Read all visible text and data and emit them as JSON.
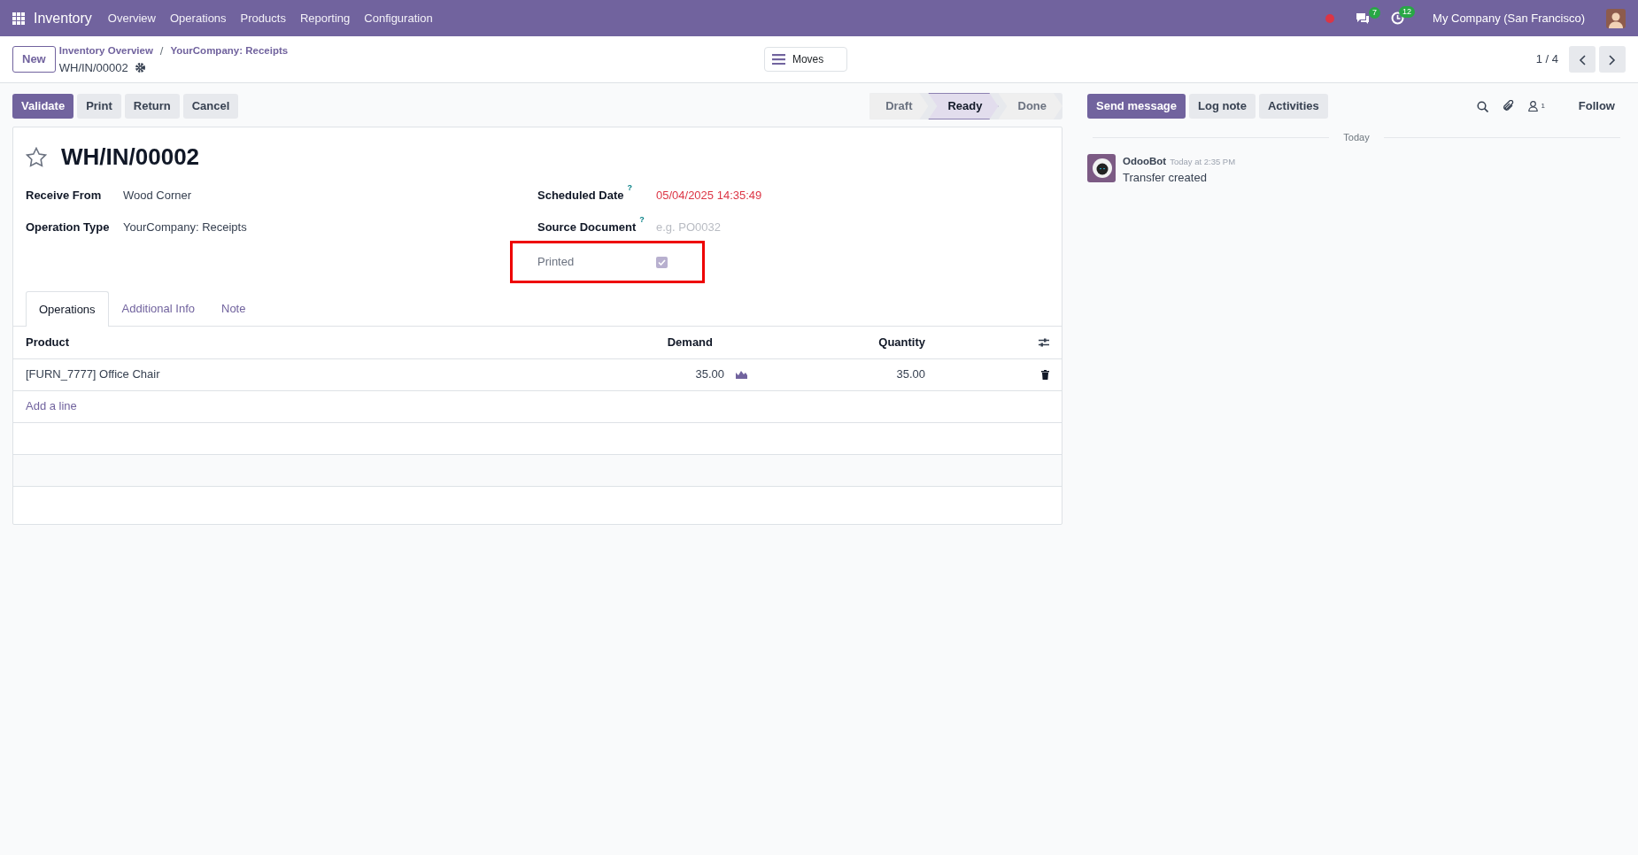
{
  "navbar": {
    "app_name": "Inventory",
    "menu": [
      "Overview",
      "Operations",
      "Products",
      "Reporting",
      "Configuration"
    ],
    "messages_count": "7",
    "activities_count": "12",
    "company": "My Company (San Francisco)"
  },
  "control_panel": {
    "new_button": "New",
    "breadcrumbs": [
      "Inventory Overview",
      "YourCompany: Receipts"
    ],
    "breadcrumb_separator": "/",
    "record_name": "WH/IN/00002",
    "smart_button": "Moves",
    "pager": "1 / 4"
  },
  "actions": [
    {
      "label": "Validate",
      "primary": true
    },
    {
      "label": "Print",
      "primary": false
    },
    {
      "label": "Return",
      "primary": false
    },
    {
      "label": "Cancel",
      "primary": false
    }
  ],
  "stages": [
    {
      "label": "Draft",
      "selected": false
    },
    {
      "label": "Ready",
      "selected": true
    },
    {
      "label": "Done",
      "selected": false
    }
  ],
  "form": {
    "title": "WH/IN/00002",
    "starred": false,
    "left_fields": [
      {
        "label": "Receive From",
        "value": "Wood Corner"
      },
      {
        "label": "Operation Type",
        "value": "YourCompany: Receipts"
      }
    ],
    "right_fields": [
      {
        "kind": "text",
        "label": "Scheduled Date",
        "help": "?",
        "value": "05/04/2025 14:35:49",
        "late": true
      },
      {
        "kind": "text",
        "label": "Source Document",
        "help": "?",
        "placeholder": "e.g. PO0032",
        "late": false
      },
      {
        "kind": "checkbox",
        "label": "Printed",
        "checked": true,
        "highlighted": true
      }
    ],
    "tabs": [
      {
        "label": "Operations",
        "selected": true
      },
      {
        "label": "Additional Info",
        "selected": false
      },
      {
        "label": "Note",
        "selected": false
      }
    ],
    "table": {
      "columns": [
        "Product",
        "Demand",
        "Quantity"
      ],
      "rows": [
        {
          "product": "[FURN_7777] Office Chair",
          "demand": "35.00",
          "quantity": "35.00"
        }
      ],
      "add_line": "Add a line"
    }
  },
  "chatter": {
    "buttons": [
      {
        "label": "Send message",
        "primary": true
      },
      {
        "label": "Log note",
        "primary": false
      },
      {
        "label": "Activities",
        "primary": false
      }
    ],
    "followers_count": "1",
    "follow": "Follow",
    "date_separator": "Today",
    "messages": [
      {
        "author": "OdooBot",
        "time": "Today at 2:35 PM",
        "body": "Transfer created"
      }
    ]
  }
}
